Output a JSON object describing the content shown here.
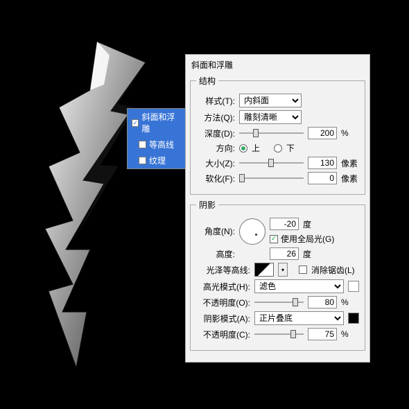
{
  "panel": {
    "title": "斜面和浮雕"
  },
  "effects_list": {
    "items": [
      {
        "label": "斜面和浮雕",
        "checked": true
      },
      {
        "label": "等高线",
        "checked": false
      },
      {
        "label": "纹理",
        "checked": false
      }
    ]
  },
  "structure": {
    "legend": "结构",
    "style_label": "样式(T):",
    "style_value": "内斜面",
    "method_label": "方法(Q):",
    "method_value": "雕刻清晰",
    "depth_label": "深度(D):",
    "depth_value": "200",
    "depth_unit": "%",
    "dir_label": "方向:",
    "dir_up": "上",
    "dir_down": "下",
    "dir_selected": "up",
    "size_label": "大小(Z):",
    "size_value": "130",
    "size_unit": "像素",
    "soften_label": "软化(F):",
    "soften_value": "0",
    "soften_unit": "像素"
  },
  "shading": {
    "legend": "阴影",
    "angle_label": "角度(N):",
    "angle_value": "-20",
    "angle_unit": "度",
    "global_light_label": "使用全局光(G)",
    "global_light_on": true,
    "altitude_label": "高度:",
    "altitude_value": "26",
    "altitude_unit": "度",
    "gloss_label": "光泽等高线:",
    "antialias_label": "消除锯齿(L)",
    "antialias_on": false,
    "hi_mode_label": "高光模式(H):",
    "hi_mode_value": "滤色",
    "hi_opacity_label": "不透明度(O):",
    "hi_opacity_value": "80",
    "hi_opacity_unit": "%",
    "sh_mode_label": "阴影模式(A):",
    "sh_mode_value": "正片叠底",
    "sh_opacity_label": "不透明度(C):",
    "sh_opacity_value": "75",
    "sh_opacity_unit": "%"
  }
}
